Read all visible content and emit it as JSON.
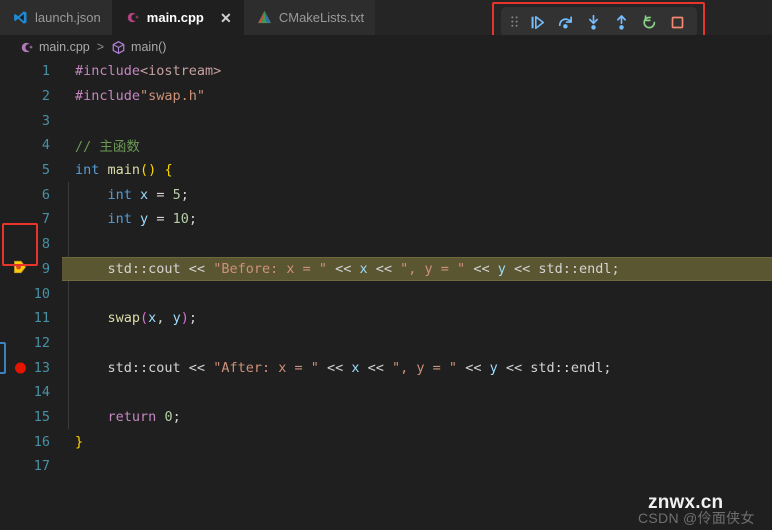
{
  "tabs": [
    {
      "label": "launch.json",
      "icon": "vscode-icon",
      "active": false,
      "closable": false
    },
    {
      "label": "main.cpp",
      "icon": "cpp-icon",
      "active": true,
      "closable": true,
      "close_label": "✕"
    },
    {
      "label": "CMakeLists.txt",
      "icon": "cmake-icon",
      "active": false,
      "closable": false
    }
  ],
  "breadcrumb": {
    "file": "main.cpp",
    "separator": ">",
    "symbol": "main()"
  },
  "debug_toolbar": {
    "buttons": [
      {
        "name": "drag-handle",
        "title": "Drag"
      },
      {
        "name": "continue-button",
        "title": "Continue"
      },
      {
        "name": "step-over-button",
        "title": "Step Over"
      },
      {
        "name": "step-into-button",
        "title": "Step Into"
      },
      {
        "name": "step-out-button",
        "title": "Step Out"
      },
      {
        "name": "restart-button",
        "title": "Restart"
      },
      {
        "name": "stop-button",
        "title": "Stop"
      }
    ],
    "highlight_color": "#e8352b"
  },
  "editor": {
    "language": "cpp",
    "current_line": 9,
    "breakpoint_lines": [
      13
    ],
    "lines": [
      {
        "num": "1",
        "tokens": [
          {
            "t": "#include",
            "c": "t-pp"
          },
          {
            "t": "<iostream>",
            "c": "t-inc"
          }
        ]
      },
      {
        "num": "2",
        "tokens": [
          {
            "t": "#include",
            "c": "t-pp"
          },
          {
            "t": "\"swap.h\"",
            "c": "t-str"
          }
        ]
      },
      {
        "num": "3",
        "tokens": []
      },
      {
        "num": "4",
        "tokens": [
          {
            "t": "// 主函数",
            "c": "t-com"
          }
        ]
      },
      {
        "num": "5",
        "tokens": [
          {
            "t": "int",
            "c": "t-kw"
          },
          {
            "t": " ",
            "c": "t-plain"
          },
          {
            "t": "main",
            "c": "t-fn"
          },
          {
            "t": "()",
            "c": "t-br1"
          },
          {
            "t": " ",
            "c": "t-plain"
          },
          {
            "t": "{",
            "c": "t-br1"
          }
        ]
      },
      {
        "num": "6",
        "tokens": [
          {
            "t": "    ",
            "c": "t-plain"
          },
          {
            "t": "int",
            "c": "t-kw"
          },
          {
            "t": " ",
            "c": "t-plain"
          },
          {
            "t": "x",
            "c": "t-var"
          },
          {
            "t": " = ",
            "c": "t-op"
          },
          {
            "t": "5",
            "c": "t-num"
          },
          {
            "t": ";",
            "c": "t-plain"
          }
        ]
      },
      {
        "num": "7",
        "tokens": [
          {
            "t": "    ",
            "c": "t-plain"
          },
          {
            "t": "int",
            "c": "t-kw"
          },
          {
            "t": " ",
            "c": "t-plain"
          },
          {
            "t": "y",
            "c": "t-var"
          },
          {
            "t": " = ",
            "c": "t-op"
          },
          {
            "t": "10",
            "c": "t-num"
          },
          {
            "t": ";",
            "c": "t-plain"
          }
        ]
      },
      {
        "num": "8",
        "tokens": []
      },
      {
        "num": "9",
        "tokens": [
          {
            "t": "    ",
            "c": "t-plain"
          },
          {
            "t": "std::cout",
            "c": "t-ns"
          },
          {
            "t": " << ",
            "c": "t-op"
          },
          {
            "t": "\"Before: x = \"",
            "c": "t-str"
          },
          {
            "t": " << ",
            "c": "t-op"
          },
          {
            "t": "x",
            "c": "t-var"
          },
          {
            "t": " << ",
            "c": "t-op"
          },
          {
            "t": "\", y = \"",
            "c": "t-str"
          },
          {
            "t": " << ",
            "c": "t-op"
          },
          {
            "t": "y",
            "c": "t-var"
          },
          {
            "t": " << ",
            "c": "t-op"
          },
          {
            "t": "std::endl",
            "c": "t-ns"
          },
          {
            "t": ";",
            "c": "t-plain"
          }
        ]
      },
      {
        "num": "10",
        "tokens": []
      },
      {
        "num": "11",
        "tokens": [
          {
            "t": "    ",
            "c": "t-plain"
          },
          {
            "t": "swap",
            "c": "t-fn"
          },
          {
            "t": "(",
            "c": "t-br2"
          },
          {
            "t": "x",
            "c": "t-var"
          },
          {
            "t": ", ",
            "c": "t-plain"
          },
          {
            "t": "y",
            "c": "t-var"
          },
          {
            "t": ")",
            "c": "t-br2"
          },
          {
            "t": ";",
            "c": "t-plain"
          }
        ]
      },
      {
        "num": "12",
        "tokens": []
      },
      {
        "num": "13",
        "tokens": [
          {
            "t": "    ",
            "c": "t-plain"
          },
          {
            "t": "std::cout",
            "c": "t-ns"
          },
          {
            "t": " << ",
            "c": "t-op"
          },
          {
            "t": "\"After: x = \"",
            "c": "t-str"
          },
          {
            "t": " << ",
            "c": "t-op"
          },
          {
            "t": "x",
            "c": "t-var"
          },
          {
            "t": " << ",
            "c": "t-op"
          },
          {
            "t": "\", y = \"",
            "c": "t-str"
          },
          {
            "t": " << ",
            "c": "t-op"
          },
          {
            "t": "y",
            "c": "t-var"
          },
          {
            "t": " << ",
            "c": "t-op"
          },
          {
            "t": "std::endl",
            "c": "t-ns"
          },
          {
            "t": ";",
            "c": "t-plain"
          }
        ]
      },
      {
        "num": "14",
        "tokens": []
      },
      {
        "num": "15",
        "tokens": [
          {
            "t": "    ",
            "c": "t-plain"
          },
          {
            "t": "return",
            "c": "t-ctl"
          },
          {
            "t": " ",
            "c": "t-plain"
          },
          {
            "t": "0",
            "c": "t-num"
          },
          {
            "t": ";",
            "c": "t-plain"
          }
        ]
      },
      {
        "num": "16",
        "tokens": [
          {
            "t": "}",
            "c": "t-br1"
          }
        ]
      },
      {
        "num": "17",
        "tokens": []
      }
    ]
  },
  "watermarks": {
    "primary": "znwx.cn",
    "secondary": "CSDN @伶面侠女"
  }
}
